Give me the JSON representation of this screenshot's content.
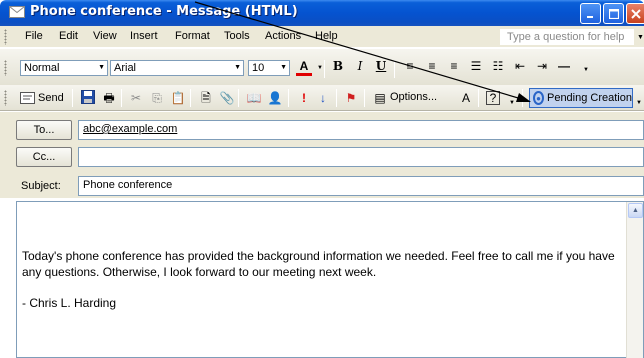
{
  "window": {
    "title": "Phone conference - Message (HTML)"
  },
  "menu": {
    "items": [
      "File",
      "Edit",
      "View",
      "Insert",
      "Format",
      "Tools",
      "Actions",
      "Help"
    ],
    "help_placeholder": "Type a question for help"
  },
  "format_toolbar": {
    "style_value": "Normal",
    "font_value": "Arial",
    "size_value": "10"
  },
  "standard_toolbar": {
    "send_label": "Send",
    "options_label": "Options...",
    "pending_label": "Pending Creation"
  },
  "headers": {
    "to_label": "To...",
    "to_value": "abc@example.com",
    "cc_label": "Cc...",
    "cc_value": "",
    "subject_label": "Subject:",
    "subject_value": "Phone conference"
  },
  "body": {
    "text": "Today's phone conference has provided the background information we needed. Feel free to call me if you have any questions. Otherwise, I look forward to our meeting next week.",
    "signature": "- Chris L. Harding"
  },
  "colors": {
    "titlebar": "#0553d0",
    "highlight_button": "#c1d2ee",
    "chrome": "#ece9d8"
  }
}
